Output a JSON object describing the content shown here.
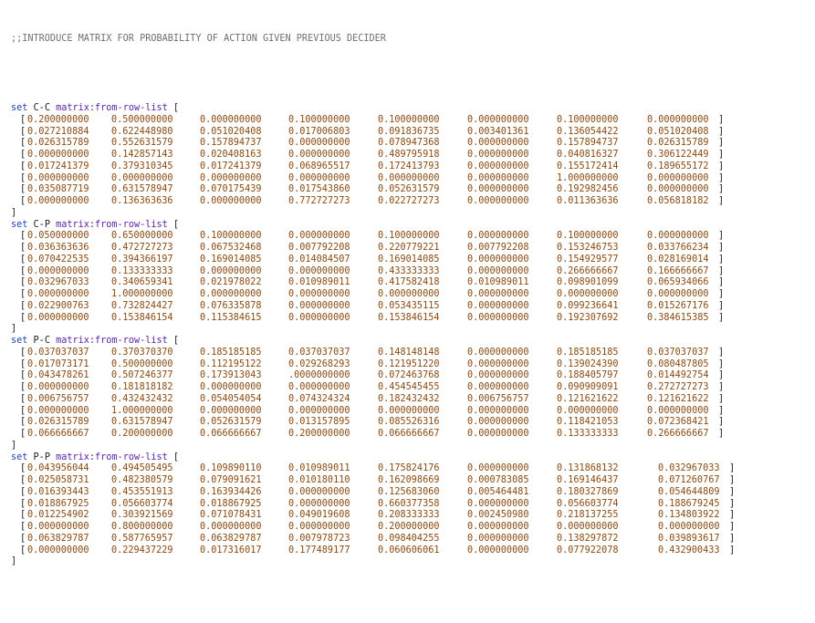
{
  "comment": ";;INTRODUCE MATRIX FOR PROBABILITY OF ACTION GIVEN PREVIOUS DECIDER",
  "keyword_set": "set",
  "primitive": "matrix:from-row-list",
  "open_list": "[",
  "close_list": "]",
  "matrices": [
    {
      "name": "C-C",
      "rows": [
        [
          "0.200000000",
          "0.500000000",
          "0.000000000",
          "0.100000000",
          "0.100000000",
          "0.000000000",
          "0.100000000",
          "0.000000000"
        ],
        [
          "0.027210884",
          "0.622448980",
          "0.051020408",
          "0.017006803",
          "0.091836735",
          "0.003401361",
          "0.136054422",
          "0.051020408"
        ],
        [
          "0.026315789",
          "0.552631579",
          "0.157894737",
          "0.000000000",
          "0.078947368",
          "0.000000000",
          "0.157894737",
          "0.026315789"
        ],
        [
          "0.000000000",
          "0.142857143",
          "0.020408163",
          "0.000000000",
          "0.489795918",
          "0.000000000",
          "0.040816327",
          "0.306122449"
        ],
        [
          "0.017241379",
          "0.379310345",
          "0.017241379",
          "0.068965517",
          "0.172413793",
          "0.000000000",
          "0.155172414",
          "0.189655172"
        ],
        [
          "0.000000000",
          "0.000000000",
          "0.000000000",
          "0.000000000",
          "0.000000000",
          "0.000000000",
          "1.000000000",
          "0.000000000"
        ],
        [
          "0.035087719",
          "0.631578947",
          "0.070175439",
          "0.017543860",
          "0.052631579",
          "0.000000000",
          "0.192982456",
          "0.000000000"
        ],
        [
          "0.000000000",
          "0.136363636",
          "0.000000000",
          "0.772727273",
          "0.022727273",
          "0.000000000",
          "0.011363636",
          "0.056818182"
        ]
      ]
    },
    {
      "name": "C-P",
      "rows": [
        [
          "0.050000000",
          "0.650000000",
          "0.100000000",
          "0.000000000",
          "0.100000000",
          "0.000000000",
          "0.100000000",
          "0.000000000"
        ],
        [
          "0.036363636",
          "0.472727273",
          "0.067532468",
          "0.007792208",
          "0.220779221",
          "0.007792208",
          "0.153246753",
          "0.033766234"
        ],
        [
          "0.070422535",
          "0.394366197",
          "0.169014085",
          "0.014084507",
          "0.169014085",
          "0.000000000",
          "0.154929577",
          "0.028169014"
        ],
        [
          "0.000000000",
          "0.133333333",
          "0.000000000",
          "0.000000000",
          "0.433333333",
          "0.000000000",
          "0.266666667",
          "0.166666667"
        ],
        [
          "0.032967033",
          "0.340659341",
          "0.021978022",
          "0.010989011",
          "0.417582418",
          "0.010989011",
          "0.098901099",
          "0.065934066"
        ],
        [
          "0.000000000",
          "1.000000000",
          "0.000000000",
          "0.000000000",
          "0.000000000",
          "0.000000000",
          "0.000000000",
          "0.000000000"
        ],
        [
          "0.022900763",
          "0.732824427",
          "0.076335878",
          "0.000000000",
          "0.053435115",
          "0.000000000",
          "0.099236641",
          "0.015267176"
        ],
        [
          "0.000000000",
          "0.153846154",
          "0.115384615",
          "0.000000000",
          "0.153846154",
          "0.000000000",
          "0.192307692",
          "0.384615385"
        ]
      ]
    },
    {
      "name": "P-C",
      "rows": [
        [
          "0.037037037",
          "0.370370370",
          "0.185185185",
          "0.037037037",
          "0.148148148",
          "0.000000000",
          "0.185185185",
          "0.037037037"
        ],
        [
          "0.017073171",
          "0.500000000",
          "0.112195122",
          "0.029268293",
          "0.121951220",
          "0.000000000",
          "0.139024390",
          "0.080487805"
        ],
        [
          "0.043478261",
          "0.507246377",
          "0.173913043",
          ".0000000000",
          "0.072463768",
          "0.000000000",
          "0.188405797",
          "0.014492754"
        ],
        [
          "0.000000000",
          "0.181818182",
          "0.000000000",
          "0.000000000",
          "0.454545455",
          "0.000000000",
          "0.090909091",
          "0.272727273"
        ],
        [
          "0.006756757",
          "0.432432432",
          "0.054054054",
          "0.074324324",
          "0.182432432",
          "0.006756757",
          "0.121621622",
          "0.121621622"
        ],
        [
          "0.000000000",
          "1.000000000",
          "0.000000000",
          "0.000000000",
          "0.000000000",
          "0.000000000",
          "0.000000000",
          "0.000000000"
        ],
        [
          "0.026315789",
          "0.631578947",
          "0.052631579",
          "0.013157895",
          "0.085526316",
          "0.000000000",
          "0.118421053",
          "0.072368421"
        ],
        [
          "0.066666667",
          "0.200000000",
          "0.066666667",
          "0.200000000",
          "0.066666667",
          "0.000000000",
          "0.133333333",
          "0.266666667"
        ]
      ]
    },
    {
      "name": "P-P",
      "rows": [
        [
          "0.043956044",
          "0.494505495",
          "0.109890110",
          "0.010989011",
          "0.175824176",
          "0.000000000",
          "0.131868132",
          "0.032967033"
        ],
        [
          "0.025058731",
          "0.482380579",
          "0.079091621",
          "0.010180110",
          "0.162098669",
          "0.000783085",
          "0.169146437",
          "0.071260767"
        ],
        [
          "0.016393443",
          "0.453551913",
          "0.163934426",
          "0.000000000",
          "0.125683060",
          "0.005464481",
          "0.180327869",
          "0.054644809"
        ],
        [
          "0.018867925",
          "0.056603774",
          "0.018867925",
          "0.000000000",
          "0.660377358",
          "0.000000000",
          "0.056603774",
          "0.188679245"
        ],
        [
          "0.012254902",
          "0.303921569",
          "0.071078431",
          "0.049019608",
          "0.208333333",
          "0.002450980",
          "0.218137255",
          "0.134803922"
        ],
        [
          "0.000000000",
          "0.800000000",
          "0.000000000",
          "0.000000000",
          "0.200000000",
          "0.000000000",
          "0.000000000",
          "0.000000000"
        ],
        [
          "0.063829787",
          "0.587765957",
          "0.063829787",
          "0.007978723",
          "0.098404255",
          "0.000000000",
          "0.138297872",
          "0.039893617"
        ],
        [
          "0.000000000",
          "0.229437229",
          "0.017316017",
          "0.177489177",
          "0.060606061",
          "0.000000000",
          "0.077922078",
          "0.432900433"
        ]
      ]
    }
  ]
}
